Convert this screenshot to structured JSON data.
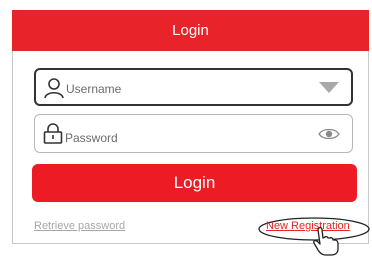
{
  "header": {
    "title": "Login"
  },
  "username": {
    "placeholder": "Username",
    "icon": "user-icon",
    "dropdown_icon": "triangle-down-icon"
  },
  "password": {
    "placeholder": "Password",
    "icon": "lock-icon",
    "toggle_icon": "eye-icon"
  },
  "login_button": {
    "label": "Login"
  },
  "links": {
    "retrieve": "Retrieve password",
    "register": "New Registration"
  },
  "colors": {
    "accent": "#e8232a",
    "button": "#ed1c24",
    "muted": "#a7a7a7"
  }
}
